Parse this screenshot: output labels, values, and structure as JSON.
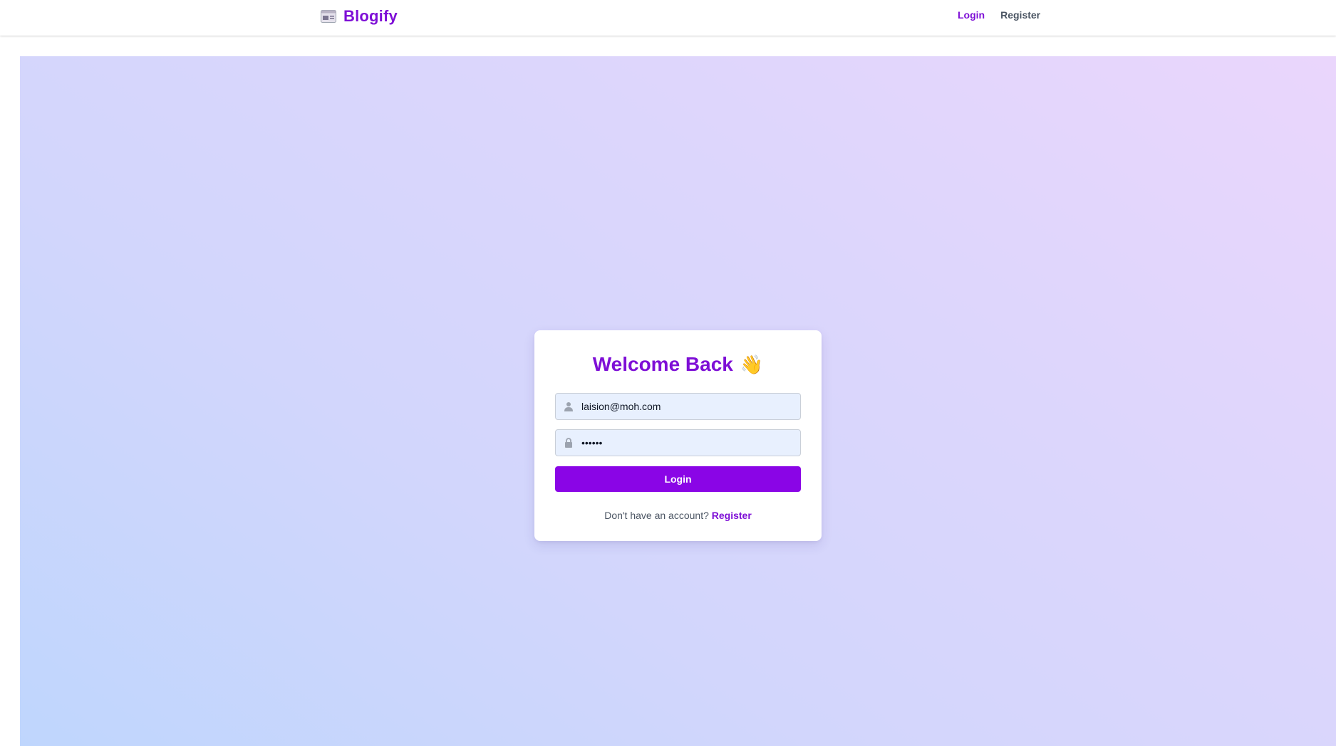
{
  "header": {
    "brand_name": "Blogify",
    "brand_icon": "newspaper-icon",
    "nav": [
      {
        "label": "Login",
        "active": true
      },
      {
        "label": "Register",
        "active": false
      }
    ]
  },
  "login_card": {
    "title": "Welcome Back",
    "title_emoji": "👋",
    "email": {
      "value": "laision@moh.com",
      "icon": "user-icon"
    },
    "password": {
      "value": "••••••",
      "icon": "lock-icon"
    },
    "submit_label": "Login",
    "footer_text": "Don't have an account?",
    "footer_link": "Register"
  },
  "colors": {
    "accent": "#7e0fd6",
    "button": "#8a05e6",
    "input_bg": "#e8f0fe"
  }
}
